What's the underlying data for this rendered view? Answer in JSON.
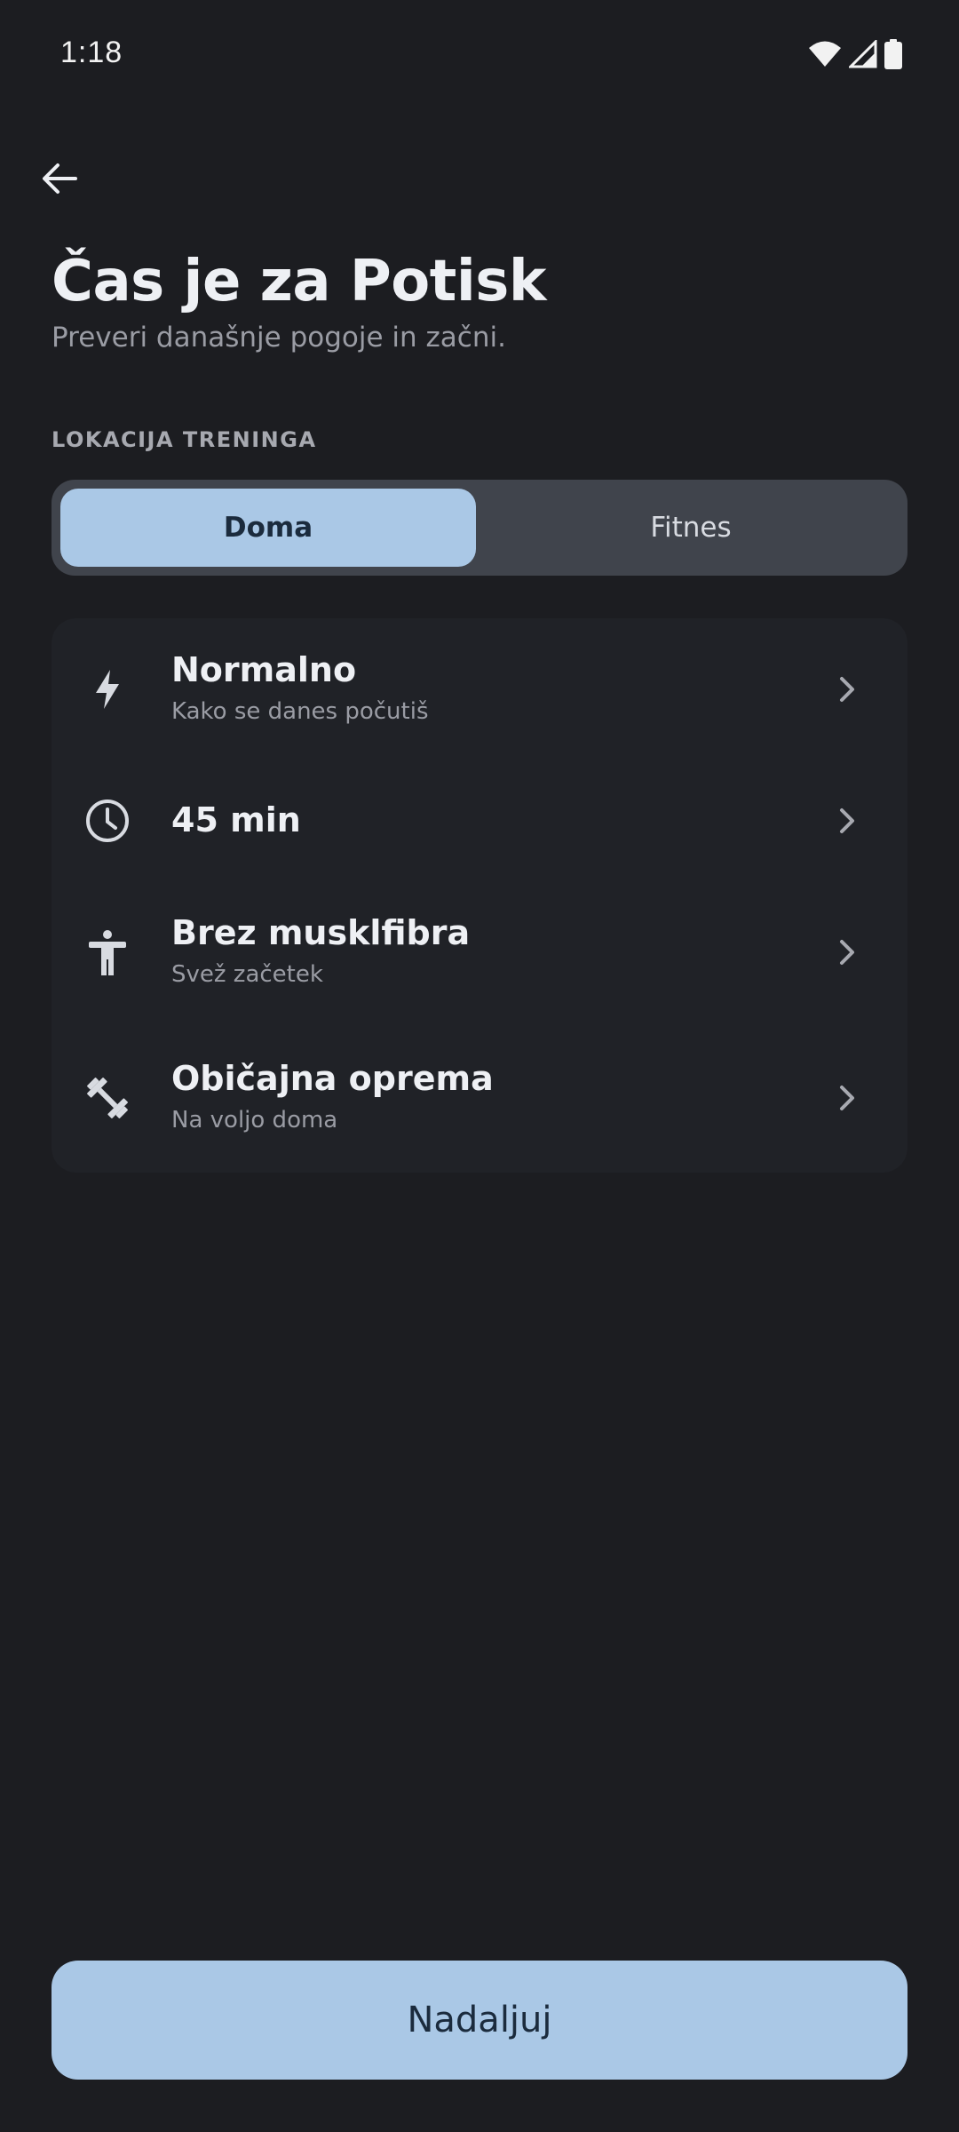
{
  "status_bar": {
    "time": "1:18",
    "icons": [
      "wifi-icon",
      "signal-icon",
      "battery-icon"
    ]
  },
  "header": {
    "back_icon": "arrow-left-icon",
    "title": "Čas je za Potisk",
    "subtitle": "Preveri današnje pogoje in začni."
  },
  "location": {
    "label": "LOKACIJA TRENINGA",
    "options": [
      {
        "label": "Doma",
        "selected": true
      },
      {
        "label": "Fitnes",
        "selected": false
      }
    ]
  },
  "options": [
    {
      "icon": "lightning-bolt-icon",
      "title": "Normalno",
      "subtitle": "Kako se danes počutiš"
    },
    {
      "icon": "clock-icon",
      "title": "45 min",
      "subtitle": ""
    },
    {
      "icon": "person-standing-icon",
      "title": "Brez musklfibra",
      "subtitle": "Svež začetek"
    },
    {
      "icon": "dumbbell-icon",
      "title": "Običajna oprema",
      "subtitle": "Na voljo doma"
    }
  ],
  "footer": {
    "continue_label": "Nadaljuj"
  },
  "colors": {
    "background": "#1c1d21",
    "accent": "#aac8e6",
    "card": "#202227",
    "segment_track": "#40444c"
  }
}
